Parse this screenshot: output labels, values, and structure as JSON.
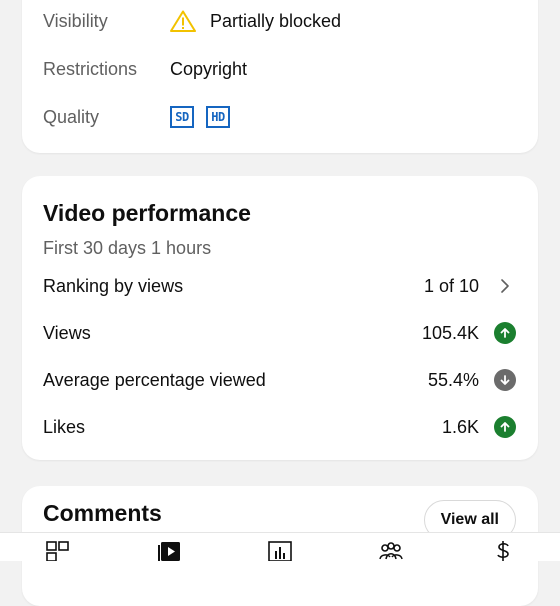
{
  "details": {
    "visibility": {
      "label": "Visibility",
      "value": "Partially blocked",
      "icon": "warning-icon"
    },
    "restrictions": {
      "label": "Restrictions",
      "value": "Copyright"
    },
    "quality": {
      "label": "Quality",
      "badges": [
        "SD",
        "HD"
      ]
    }
  },
  "performance": {
    "title": "Video performance",
    "subtitle": "First 30 days 1 hours",
    "rows": [
      {
        "label": "Ranking by views",
        "value": "1 of 10",
        "icon": "chevron-right-icon"
      },
      {
        "label": "Views",
        "value": "105.4K",
        "icon": "arrow-up-icon"
      },
      {
        "label": "Average percentage viewed",
        "value": "55.4%",
        "icon": "arrow-down-icon"
      },
      {
        "label": "Likes",
        "value": "1.6K",
        "icon": "arrow-up-icon"
      }
    ]
  },
  "comments": {
    "title": "Comments",
    "view_all_label": "View all"
  },
  "nav": {
    "items": [
      "dashboard-icon",
      "content-icon",
      "analytics-icon",
      "community-icon",
      "earn-icon"
    ]
  },
  "colors": {
    "up": "#1b7f2f",
    "down": "#6b6b6b",
    "badge": "#1565c0",
    "warning": "#f2c200"
  }
}
